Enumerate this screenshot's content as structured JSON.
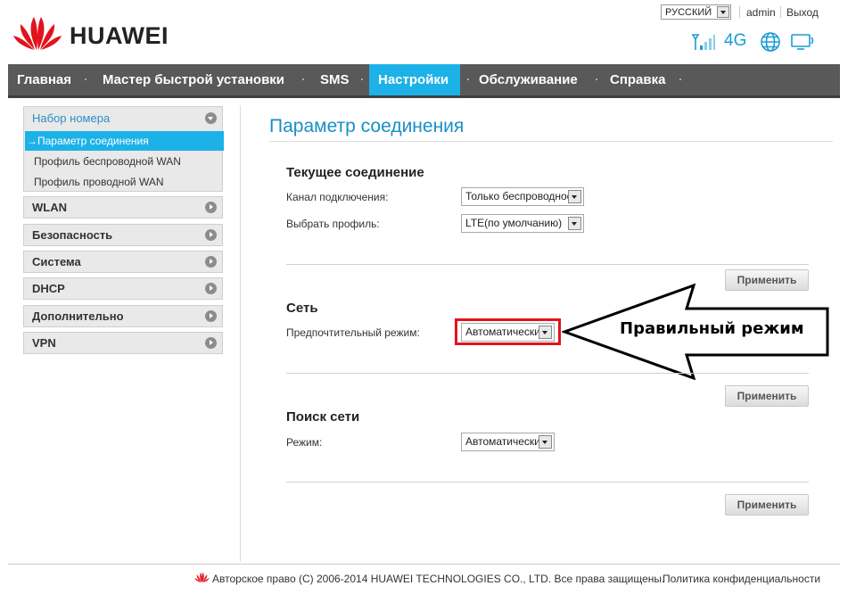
{
  "header": {
    "brand": "HUAWEI",
    "language": "РУССКИЙ",
    "user": "admin",
    "logout": "Выход",
    "network_type": "4G"
  },
  "nav": {
    "items": [
      {
        "label": "Главная"
      },
      {
        "label": "Мастер быстрой установки"
      },
      {
        "label": "SMS"
      },
      {
        "label": "Настройки"
      },
      {
        "label": "Обслуживание"
      },
      {
        "label": "Справка"
      }
    ],
    "active": "Настройки"
  },
  "sidebar": {
    "open_group": "Набор номера",
    "sub_items": [
      {
        "label": "→Параметр соединения"
      },
      {
        "label": "Профиль беспроводной WAN"
      },
      {
        "label": "Профиль проводной WAN"
      }
    ],
    "groups": [
      {
        "label": "WLAN"
      },
      {
        "label": "Безопасность"
      },
      {
        "label": "Система"
      },
      {
        "label": "DHCP"
      },
      {
        "label": "Дополнительно"
      },
      {
        "label": "VPN"
      }
    ]
  },
  "main": {
    "title": "Параметр соединения",
    "current_connection": {
      "title": "Текущее соединение",
      "channel_label": "Канал подключения:",
      "channel_value": "Только беспроводное",
      "profile_label": "Выбрать профиль:",
      "profile_value": "LTE(по умолчанию)"
    },
    "network": {
      "title": "Сеть",
      "mode_label": "Предпочтительный режим:",
      "mode_value": "Автоматически"
    },
    "search": {
      "title": "Поиск сети",
      "mode_label": "Режим:",
      "mode_value": "Автоматически"
    },
    "apply_label": "Применить"
  },
  "annotation": {
    "text": "Правильный режим"
  },
  "footer": {
    "copyright": "Авторское право (C) 2006-2014 HUAWEI TECHNOLOGIES CO., LTD. Все права защищены.",
    "privacy": "Политика конфиденциальности"
  },
  "colors": {
    "accent": "#1cb2e8",
    "brand_red": "#e1131c",
    "nav_bg": "#595959"
  }
}
